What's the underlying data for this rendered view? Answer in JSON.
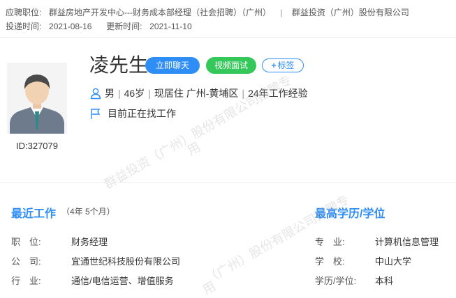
{
  "header": {
    "position_label": "应聘职位:",
    "position_value": "群益房地产开发中心---财务成本部经理（社会招聘）（广州）",
    "separator": "|",
    "company": "群益投资（广州）股份有限公司",
    "delivery_label": "投递时间:",
    "delivery_value": "2021-08-16",
    "update_label": "更新时间:",
    "update_value": "2021-11-10"
  },
  "profile": {
    "name": "凌先生",
    "chat_button": "立即聊天",
    "video_button": "视频面试",
    "tag_button_plus": "+",
    "tag_button": "标签",
    "gender": "男",
    "age": "46岁",
    "residence": "现居住 广州-黄埔区",
    "experience": "24年工作经验",
    "bar": "|",
    "job_status": "目前正在找工作",
    "id": "ID:327079"
  },
  "watermark": {
    "line1": "群益投资（广州）股份有限公司招聘专用",
    "line1a": "群益投资（广州）股份有限公司招聘专",
    "line1b": "用",
    "line2a": "（广州）股份有限公司招聘专",
    "line2b": "用"
  },
  "recent_work": {
    "title": "最近工作",
    "duration": "（4年 5个月）",
    "fields": [
      {
        "label": "职　位:",
        "value": "财务经理"
      },
      {
        "label": "公　司:",
        "value": "宜通世纪科技股份有限公司"
      },
      {
        "label": "行　业:",
        "value": "通信/电信运营、增值服务"
      }
    ]
  },
  "education": {
    "title": "最高学历/学位",
    "fields": [
      {
        "label": "专　业:",
        "value": "计算机信息管理"
      },
      {
        "label": "学　校:",
        "value": "中山大学"
      },
      {
        "label": "学历/学位:",
        "value": "本科"
      }
    ]
  },
  "colors": {
    "accent": "#2f8ef5",
    "video": "#34c759"
  }
}
